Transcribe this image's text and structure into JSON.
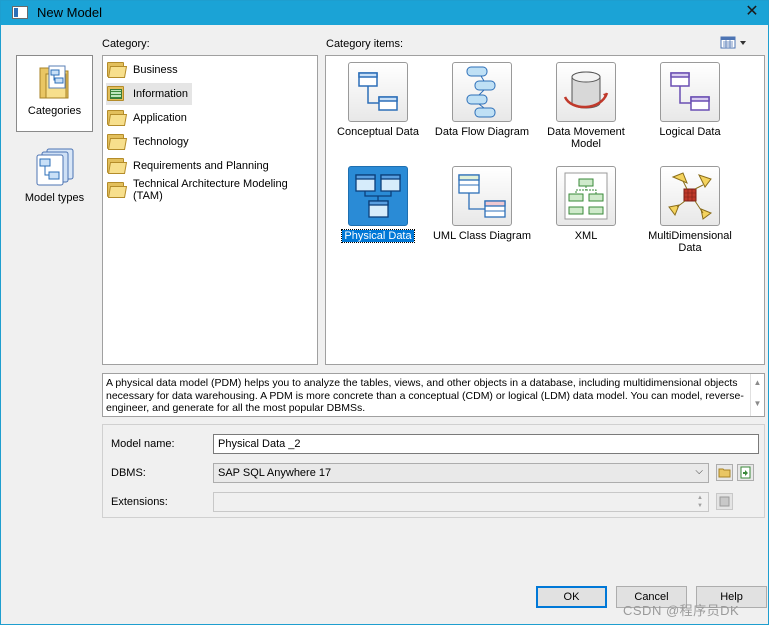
{
  "window": {
    "title": "New Model",
    "close_icon": "close-icon"
  },
  "left_nav": {
    "items": [
      {
        "label": "Categories",
        "icon": "categories-icon",
        "selected": true
      },
      {
        "label": "Model types",
        "icon": "model-types-icon",
        "selected": false
      }
    ]
  },
  "category": {
    "label": "Category:",
    "items": [
      {
        "label": "Business",
        "icon": "folder-icon"
      },
      {
        "label": "Information",
        "icon": "information-folder-icon",
        "selected": true
      },
      {
        "label": "Application",
        "icon": "folder-icon"
      },
      {
        "label": "Technology",
        "icon": "folder-icon"
      },
      {
        "label": "Requirements and Planning",
        "icon": "folder-icon"
      },
      {
        "label": "Technical Architecture Modeling (TAM)",
        "icon": "folder-icon"
      }
    ]
  },
  "category_items": {
    "label": "Category items:",
    "view_toggle_icon": "large-icons-view-icon",
    "items": [
      {
        "label": "Conceptual Data",
        "icon": "conceptual-data-icon"
      },
      {
        "label": "Data Flow Diagram",
        "icon": "data-flow-diagram-icon"
      },
      {
        "label": "Data Movement Model",
        "icon": "data-movement-model-icon"
      },
      {
        "label": "Logical Data",
        "icon": "logical-data-icon"
      },
      {
        "label": "Physical Data",
        "icon": "physical-data-icon",
        "selected": true
      },
      {
        "label": "UML Class Diagram",
        "icon": "uml-class-diagram-icon"
      },
      {
        "label": "XML",
        "icon": "xml-icon"
      },
      {
        "label": "MultiDimensional Data",
        "icon": "multidimensional-data-icon"
      }
    ]
  },
  "description": {
    "text": "A physical data model (PDM) helps you to analyze the tables, views, and other objects in a database, including multidimensional objects necessary for data warehousing. A PDM is more concrete than a conceptual (CDM) or logical (LDM) data model. You can model, reverse-engineer, and generate for all the most popular DBMSs."
  },
  "form": {
    "model_name_label": "Model name:",
    "model_name_value": "Physical Data _2",
    "dbms_label": "DBMS:",
    "dbms_value": "SAP SQL Anywhere 17",
    "extensions_label": "Extensions:",
    "extensions_value": ""
  },
  "buttons": {
    "ok": "OK",
    "cancel": "Cancel",
    "help": "Help"
  },
  "watermark": "CSDN @程序员DK"
}
